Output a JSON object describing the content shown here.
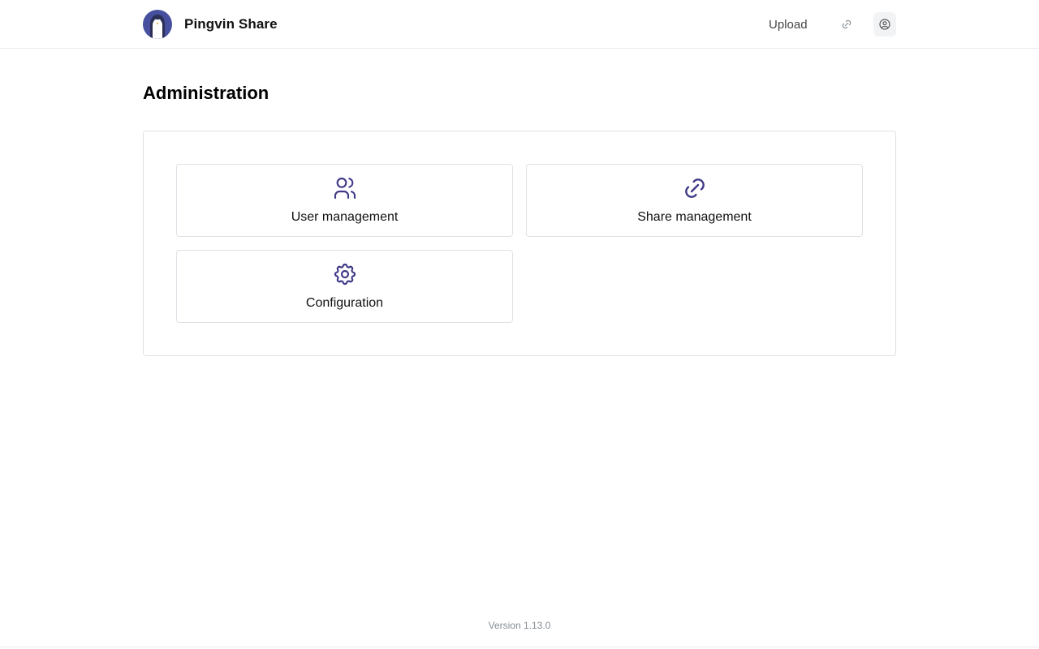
{
  "header": {
    "app_name": "Pingvin Share",
    "upload_label": "Upload",
    "links_icon": "link-icon",
    "user_icon": "user-circle-icon"
  },
  "main": {
    "title": "Administration",
    "cards": [
      {
        "label": "User management",
        "icon": "users-icon"
      },
      {
        "label": "Share management",
        "icon": "link-icon"
      },
      {
        "label": "Configuration",
        "icon": "gear-icon"
      }
    ]
  },
  "footer": {
    "version": "Version 1.13.0"
  },
  "colors": {
    "accent": "#3f3a87",
    "logo_bg": "#46509e",
    "border": "#dee2e6"
  }
}
